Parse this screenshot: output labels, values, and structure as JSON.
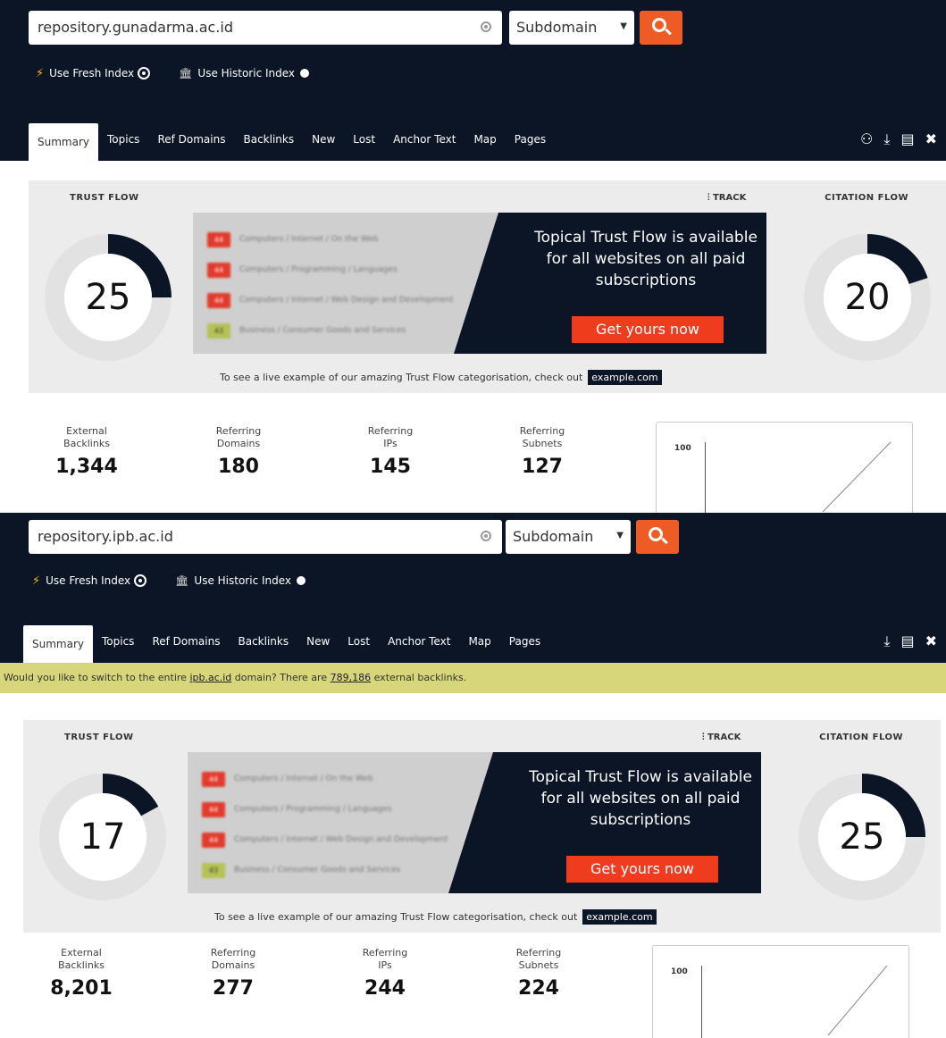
{
  "panels": [
    {
      "search": {
        "query": "repository.gunadarma.ac.id",
        "scope": "Subdomain"
      },
      "index_options": {
        "fresh": "Use Fresh Index",
        "historic": "Use Historic Index"
      },
      "tabs": [
        "Summary",
        "Topics",
        "Ref Domains",
        "Backlinks",
        "New",
        "Lost",
        "Anchor Text",
        "Map",
        "Pages"
      ],
      "tools": [
        "people-icon",
        "download-icon",
        "report-icon",
        "tools-icon"
      ],
      "trust_flow": {
        "label": "TRUST FLOW",
        "value": "25",
        "level": 25
      },
      "citation_flow": {
        "label": "CITATION FLOW",
        "value": "20",
        "level": 20
      },
      "track_label": "TRACK",
      "topical": {
        "rows": [
          {
            "num": "44",
            "text": "Computers / Internet / On the Web"
          },
          {
            "num": "44",
            "text": "Computers / Programming / Languages"
          },
          {
            "num": "44",
            "text": "Computers / Internet / Web Design and Development"
          },
          {
            "num": "43",
            "text": "Business / Consumer Goods and Services"
          }
        ],
        "message": "Topical Trust Flow is available for all websites on all paid subscriptions",
        "cta": "Get yours now"
      },
      "example_text": "To see a live example of our amazing Trust Flow categorisation, check out",
      "example_link": "example.com",
      "stats": [
        {
          "label": "External\nBacklinks",
          "value": "1,344"
        },
        {
          "label": "Referring\nDomains",
          "value": "180"
        },
        {
          "label": "Referring\nIPs",
          "value": "145"
        },
        {
          "label": "Referring\nSubnets",
          "value": "127"
        }
      ],
      "mini_chart": {
        "ytick": "100"
      }
    },
    {
      "search": {
        "query": "repository.ipb.ac.id",
        "scope": "Subdomain"
      },
      "index_options": {
        "fresh": "Use Fresh Index",
        "historic": "Use Historic Index"
      },
      "tabs": [
        "Summary",
        "Topics",
        "Ref Domains",
        "Backlinks",
        "New",
        "Lost",
        "Anchor Text",
        "Map",
        "Pages"
      ],
      "tools": [
        "download-icon",
        "report-icon",
        "tools-icon"
      ],
      "banner": {
        "prefix": "Would you like to switch to the entire ",
        "domain": "ipb.ac.id",
        "middle": " domain? There are ",
        "count": "789,186",
        "suffix": " external backlinks."
      },
      "trust_flow": {
        "label": "TRUST FLOW",
        "value": "17",
        "level": 17
      },
      "citation_flow": {
        "label": "CITATION FLOW",
        "value": "25",
        "level": 25
      },
      "track_label": "TRACK",
      "topical": {
        "rows": [
          {
            "num": "44",
            "text": "Computers / Internet / On the Web"
          },
          {
            "num": "44",
            "text": "Computers / Programming / Languages"
          },
          {
            "num": "44",
            "text": "Computers / Internet / Web Design and Development"
          },
          {
            "num": "43",
            "text": "Business / Consumer Goods and Services"
          }
        ],
        "message": "Topical Trust Flow is available for all websites on all paid subscriptions",
        "cta": "Get yours now"
      },
      "example_text": "To see a live example of our amazing Trust Flow categorisation, check out",
      "example_link": "example.com",
      "stats": [
        {
          "label": "External\nBacklinks",
          "value": "8,201"
        },
        {
          "label": "Referring\nDomains",
          "value": "277"
        },
        {
          "label": "Referring\nIPs",
          "value": "244"
        },
        {
          "label": "Referring\nSubnets",
          "value": "224"
        }
      ],
      "mini_chart": {
        "ytick": "100"
      }
    }
  ],
  "colors": {
    "header_bg": "#0b1526",
    "accent": "#ef5b25",
    "cta": "#ef3b1e",
    "banner": "#d8d67a",
    "panel_bg": "#ececec"
  }
}
